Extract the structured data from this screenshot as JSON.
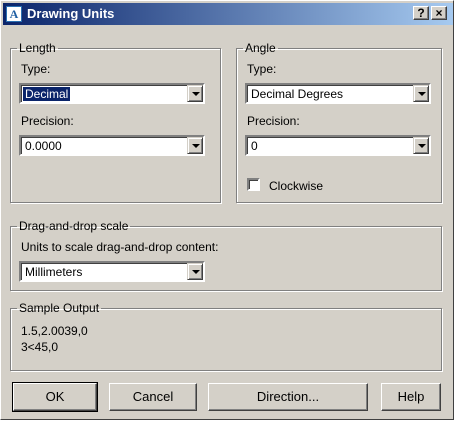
{
  "window": {
    "title": "Drawing Units",
    "icon": "autocad-icon",
    "help_glyph": "?",
    "close_glyph": "×"
  },
  "length": {
    "group_label": "Length",
    "type_label": "Type:",
    "type_value": "Decimal",
    "precision_label": "Precision:",
    "precision_value": "0.0000"
  },
  "angle": {
    "group_label": "Angle",
    "type_label": "Type:",
    "type_value": "Decimal Degrees",
    "precision_label": "Precision:",
    "precision_value": "0",
    "clockwise_label": "Clockwise",
    "clockwise_checked": false
  },
  "dragdrop": {
    "group_label": "Drag-and-drop scale",
    "units_label": "Units to scale drag-and-drop content:",
    "units_value": "Millimeters"
  },
  "sample": {
    "group_label": "Sample Output",
    "line1": "1.5,2.0039,0",
    "line2": "3<45,0"
  },
  "buttons": {
    "ok": "OK",
    "cancel": "Cancel",
    "direction": "Direction...",
    "help": "Help"
  }
}
